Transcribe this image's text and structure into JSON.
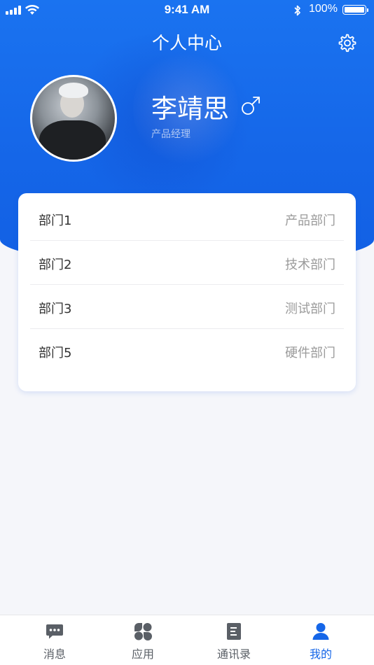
{
  "status_bar": {
    "time": "9:41 AM",
    "battery": "100%"
  },
  "header": {
    "title": "个人中心",
    "settings_icon": "gear-icon"
  },
  "profile": {
    "name": "李靖思",
    "gender_symbol": "♂",
    "job_title": "产品经理"
  },
  "departments": [
    {
      "label": "部门1",
      "value": "产品部门"
    },
    {
      "label": "部门2",
      "value": "技术部门"
    },
    {
      "label": "部门3",
      "value": "测试部门"
    },
    {
      "label": "部门5",
      "value": "硬件部门"
    }
  ],
  "tabs": [
    {
      "label": "消息",
      "icon": "message-icon",
      "active": false
    },
    {
      "label": "应用",
      "icon": "apps-icon",
      "active": false
    },
    {
      "label": "通讯录",
      "icon": "contacts-icon",
      "active": false
    },
    {
      "label": "我的",
      "icon": "profile-icon",
      "active": true
    }
  ],
  "colors": {
    "primary": "#1566e8",
    "background": "#f5f6fa",
    "tab_inactive": "#5a5f66"
  }
}
